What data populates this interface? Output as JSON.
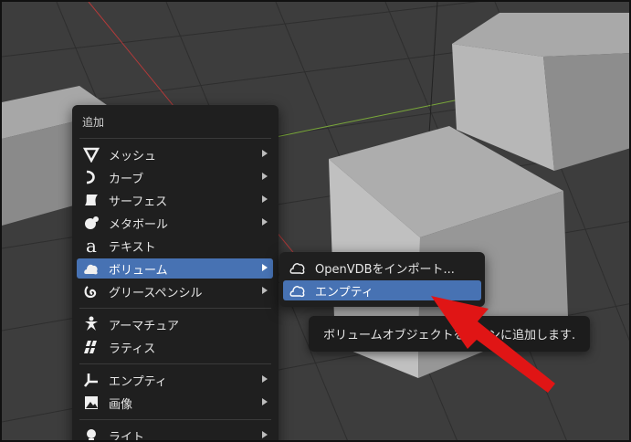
{
  "add_menu": {
    "title": "追加",
    "items": [
      {
        "label": "メッシュ",
        "icon": "mesh-icon",
        "submenu": true
      },
      {
        "label": "カーブ",
        "icon": "curve-icon",
        "submenu": true
      },
      {
        "label": "サーフェス",
        "icon": "surface-icon",
        "submenu": true
      },
      {
        "label": "メタボール",
        "icon": "metaball-icon",
        "submenu": true
      },
      {
        "label": "テキスト",
        "icon": "text-icon",
        "submenu": false
      },
      {
        "label": "ボリューム",
        "icon": "volume-icon",
        "submenu": true,
        "active": true
      },
      {
        "label": "グリースペンシル",
        "icon": "grease-pencil-icon",
        "submenu": true
      },
      {
        "label": "アーマチュア",
        "icon": "armature-icon",
        "submenu": false
      },
      {
        "label": "ラティス",
        "icon": "lattice-icon",
        "submenu": false
      },
      {
        "label": "エンプティ",
        "icon": "empty-icon",
        "submenu": true
      },
      {
        "label": "画像",
        "icon": "image-icon",
        "submenu": true
      },
      {
        "label": "ライト",
        "icon": "light-icon",
        "submenu": true
      }
    ]
  },
  "volume_submenu": {
    "items": [
      {
        "label": "OpenVDBをインポート...",
        "icon": "volume-icon"
      },
      {
        "label": "エンプティ",
        "icon": "volume-icon",
        "active": true
      }
    ]
  },
  "tooltip": {
    "text": "ボリュームオブジェクトをシーンに追加します."
  },
  "colors": {
    "highlight": "#4772b3",
    "menu_bg": "#1f1f1f",
    "annotation_arrow": "#e01515",
    "x_axis": "#b33a3a",
    "y_axis": "#7aa83a"
  }
}
